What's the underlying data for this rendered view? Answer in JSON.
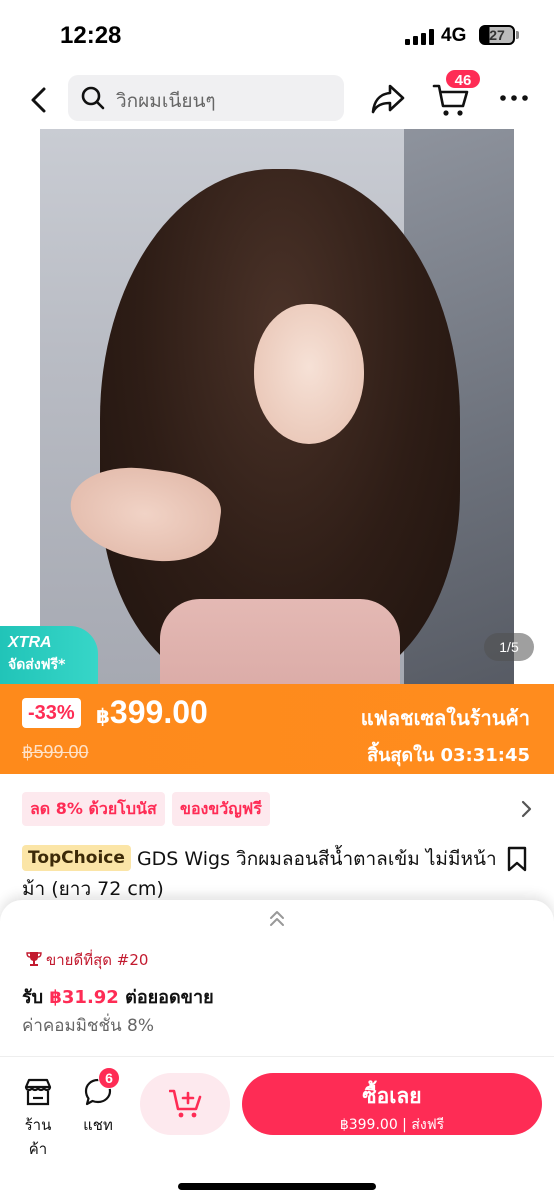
{
  "status_bar": {
    "time": "12:28",
    "network": "4G",
    "battery": "27"
  },
  "top_nav": {
    "search_text": "วิกผมเนียนๆ",
    "cart_count": "46"
  },
  "hero": {
    "xtra_title": "XTRA",
    "xtra_subtitle": "จัดส่งฟรี*",
    "page_indicator": "1/5"
  },
  "flash_sale": {
    "discount": "-33%",
    "currency": "฿",
    "price": "399.00",
    "original_price": "฿599.00",
    "label": "แฟลชเซลในร้านค้า",
    "countdown": "สิ้นสุดใน 03:31:45"
  },
  "promos": {
    "bonus": "ลด 8% ด้วยโบนัส",
    "gift": "ของขวัญฟรี"
  },
  "product": {
    "badge": "TopChoice",
    "title": "GDS Wigs วิกผมลอนสีน้ำตาลเข้ม ไม่มีหน้าม้า (ยาว 72 cm)"
  },
  "sheet": {
    "bestseller": "ขายดีที่สุด #20",
    "earn_prefix": "รับ",
    "earn_amount": "฿31.92",
    "earn_suffix": "ต่อยอดขาย",
    "commission": "ค่าคอมมิชชั่น 8%"
  },
  "action_bar": {
    "shop_label": "ร้านค้า",
    "chat_label": "แชท",
    "chat_count": "6",
    "buy_label": "ซื้อเลย",
    "buy_sub": "฿399.00 | ส่งฟรี"
  },
  "colors": {
    "brand": "#fe2c55",
    "flash": "#fe8a1b",
    "xtra": "#21c4b8"
  }
}
